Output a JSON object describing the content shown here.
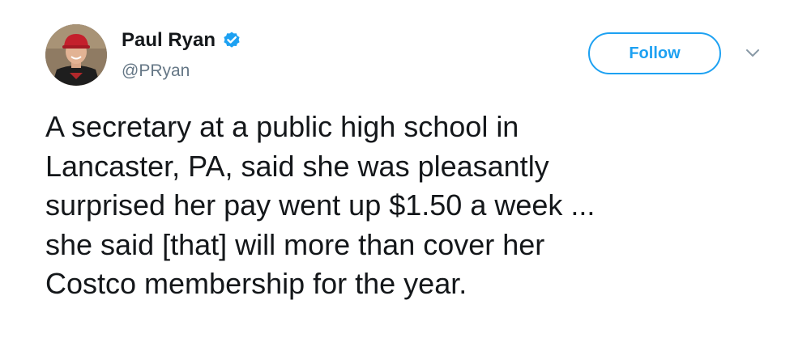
{
  "author": {
    "display_name": "Paul Ryan",
    "handle": "@PRyan",
    "verified": true,
    "avatar_icon": "profile-photo"
  },
  "actions": {
    "follow_label": "Follow",
    "more_icon": "chevron-down-icon"
  },
  "tweet": {
    "lines": [
      "A secretary at a public high school in",
      "Lancaster, PA, said she was pleasantly",
      "surprised her pay went up $1.50 a week ...",
      "she said [that] will more than cover her",
      "Costco membership for the year."
    ]
  },
  "colors": {
    "accent": "#1da1f2",
    "text": "#14171a",
    "secondary_text": "#657786",
    "background": "#ffffff"
  }
}
